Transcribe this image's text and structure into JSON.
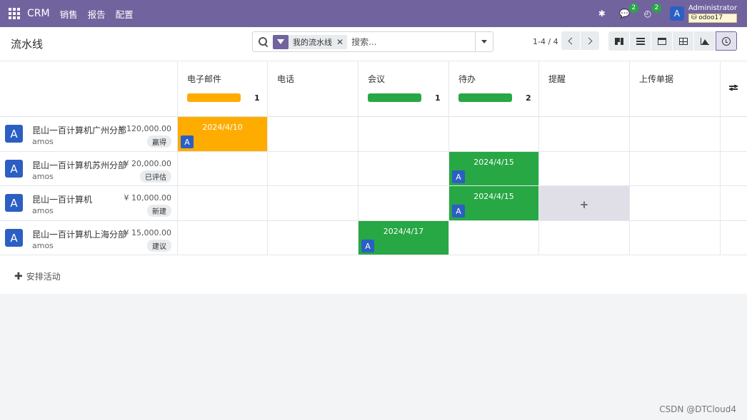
{
  "navbar": {
    "brand": "CRM",
    "menus": [
      "销售",
      "报告",
      "配置"
    ],
    "messages_count": "2",
    "activities_count": "2",
    "user_initial": "A",
    "user_name": "Administrator",
    "db_name": "odoo17"
  },
  "control_panel": {
    "title": "流水线",
    "facet_label": "我的流水线",
    "search_placeholder": "搜索...",
    "pager_value": "1-4 / 4"
  },
  "activity_types": [
    {
      "name": "电子邮件",
      "progress_color": "#ffac00",
      "count": "1"
    },
    {
      "name": "电话"
    },
    {
      "name": "会议",
      "progress_color": "#28a745",
      "count": "1"
    },
    {
      "name": "待办",
      "progress_color": "#28a745",
      "count": "2"
    },
    {
      "name": "提醒"
    },
    {
      "name": "上传单据"
    }
  ],
  "records": [
    {
      "initial": "A",
      "name": "昆山一百计算机广州分部",
      "amount": "¥ 120,000.00",
      "user": "amos",
      "stage": "赢得"
    },
    {
      "initial": "A",
      "name": "昆山一百计算机苏州分部",
      "amount": "¥ 20,000.00",
      "user": "amos",
      "stage": "已评估"
    },
    {
      "initial": "A",
      "name": "昆山一百计算机",
      "amount": "¥ 10,000.00",
      "user": "amos",
      "stage": "新建"
    },
    {
      "initial": "A",
      "name": "昆山一百计算机上海分部",
      "amount": "¥ 15,000.00",
      "user": "amos",
      "stage": "建议"
    }
  ],
  "activities": [
    {
      "date": "2024/4/10",
      "avatar": "A",
      "color": "#ffac00"
    },
    {
      "date": "2024/4/15",
      "avatar": "A",
      "color": "#28a745"
    },
    {
      "date": "2024/4/15",
      "avatar": "A",
      "color": "#28a745"
    },
    {
      "date": "2024/4/17",
      "avatar": "A",
      "color": "#28a745"
    }
  ],
  "add_cell_symbol": "+",
  "schedule_activity_label": "安排活动",
  "watermark": "CSDN @DTCloud4"
}
